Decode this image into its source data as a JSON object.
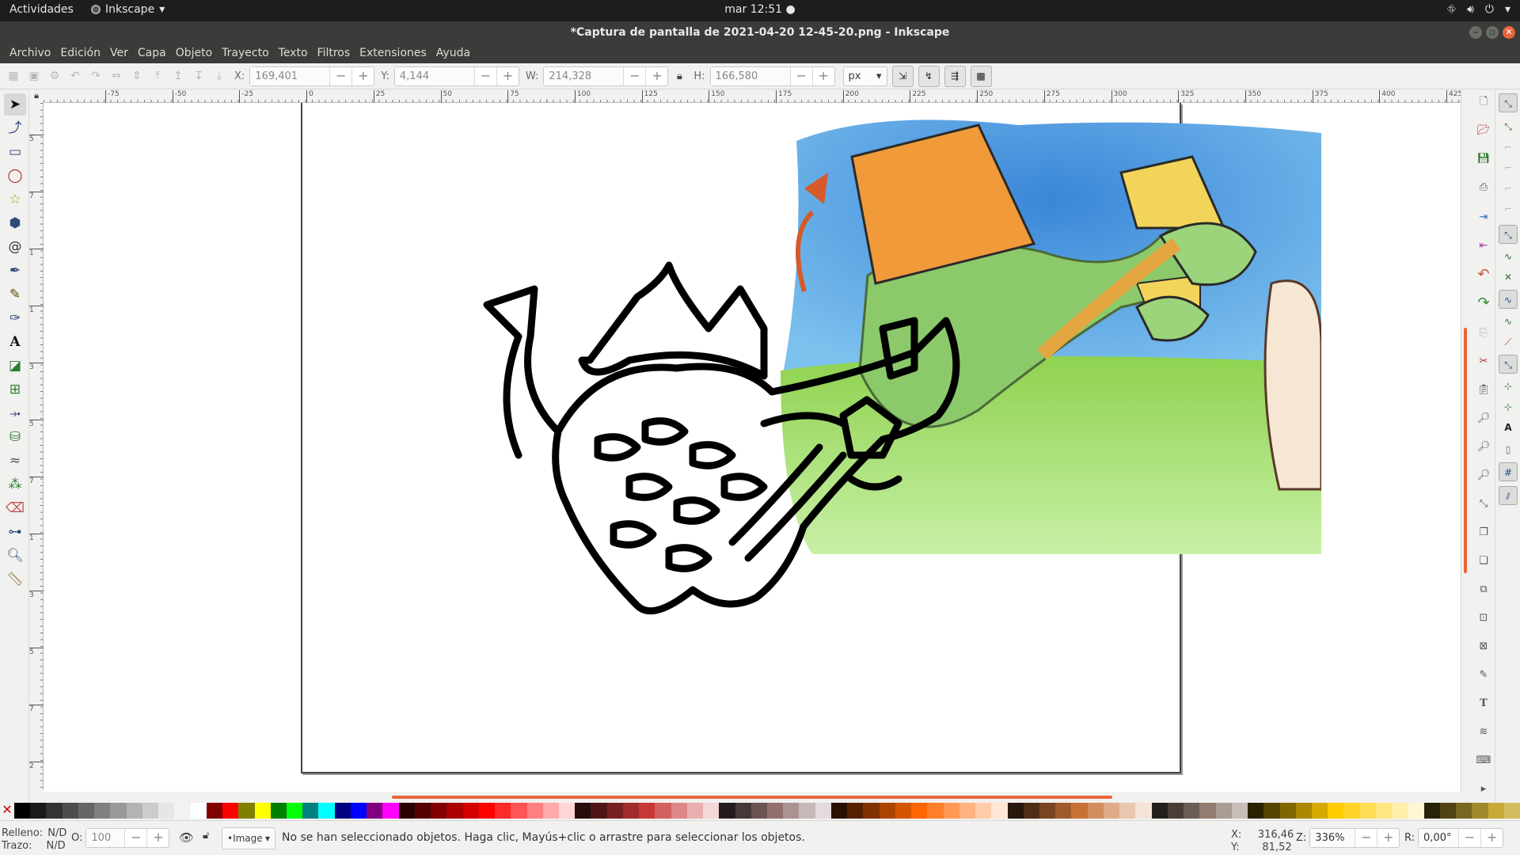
{
  "topbar": {
    "activities": "Actividades",
    "app_name": "Inkscape",
    "clock": "mar 12:51"
  },
  "window": {
    "title": "*Captura de pantalla de 2021-04-20 12-45-20.png - Inkscape"
  },
  "menu": [
    "Archivo",
    "Edición",
    "Ver",
    "Capa",
    "Objeto",
    "Trayecto",
    "Texto",
    "Filtros",
    "Extensiones",
    "Ayuda"
  ],
  "toolctrl": {
    "x_label": "X:",
    "x_value": "169,401",
    "y_label": "Y:",
    "y_value": "4,144",
    "w_label": "W:",
    "w_value": "214,328",
    "h_label": "H:",
    "h_value": "166,580",
    "unit": "px",
    "minus": "−",
    "plus": "+"
  },
  "ruler_h": [
    "-75",
    "-50",
    "-25",
    "0",
    "25",
    "50",
    "75",
    "100",
    "125",
    "150",
    "175",
    "200",
    "225",
    "250",
    "275",
    "300",
    "325",
    "350",
    "375",
    "400",
    "425"
  ],
  "ruler_v": [
    "5",
    "7",
    "1",
    "1",
    "3",
    "5",
    "7",
    "1",
    "3",
    "5",
    "7",
    "2"
  ],
  "status": {
    "fill_label": "Relleno:",
    "fill_value": "N/D",
    "stroke_label": "Trazo:",
    "stroke_value": "N/D",
    "opacity_label": "O:",
    "opacity_value": "100",
    "layer": "•Image",
    "message": "No se han seleccionado objetos. Haga clic, Mayús+clic o arrastre para seleccionar los objetos.",
    "x_label": "X:",
    "x_value": "316,46",
    "y_label": "Y:",
    "y_value": "81,52",
    "zoom_label": "Z:",
    "zoom_value": "336%",
    "rot_label": "R:",
    "rot_value": "0,00°"
  },
  "palette_colors": [
    "#000000",
    "#1a1a1a",
    "#333333",
    "#4d4d4d",
    "#666666",
    "#808080",
    "#999999",
    "#b3b3b3",
    "#cccccc",
    "#e6e6e6",
    "#f2f2f2",
    "#ffffff",
    "#800000",
    "#ff0000",
    "#808000",
    "#ffff00",
    "#008000",
    "#00ff00",
    "#008080",
    "#00ffff",
    "#000080",
    "#0000ff",
    "#800080",
    "#ff00ff",
    "#2b0000",
    "#550000",
    "#800000",
    "#aa0000",
    "#d40000",
    "#ff0000",
    "#ff2a2a",
    "#ff5555",
    "#ff8080",
    "#ffaaaa",
    "#ffd5d5",
    "#280b0b",
    "#501616",
    "#782121",
    "#a02c2c",
    "#c83737",
    "#d35f5f",
    "#de8787",
    "#e9afaf",
    "#f4d7d7",
    "#241c1c",
    "#483737",
    "#6c5353",
    "#916f6f",
    "#ac9393",
    "#c8b7b7",
    "#e3dbdb",
    "#2b1100",
    "#552200",
    "#803300",
    "#aa4400",
    "#d45500",
    "#ff6600",
    "#ff7f2a",
    "#ff9955",
    "#ffb380",
    "#ffccaa",
    "#ffe6d5",
    "#28170b",
    "#502d16",
    "#784421",
    "#a05a2c",
    "#c87137",
    "#d38d5f",
    "#deaa87",
    "#e9c6af",
    "#f4e3d7",
    "#241f1c",
    "#483e37",
    "#6c5d53",
    "#917c6f",
    "#ac9d93",
    "#c8beb7",
    "#2b2200",
    "#554400",
    "#806600",
    "#aa8800",
    "#d4aa00",
    "#ffcc00",
    "#ffd42a",
    "#ffdd55",
    "#ffe680",
    "#ffeeaa",
    "#fff6d5",
    "#28220b",
    "#504416",
    "#786721",
    "#a0892c",
    "#c8ab37",
    "#d3bc5f"
  ]
}
